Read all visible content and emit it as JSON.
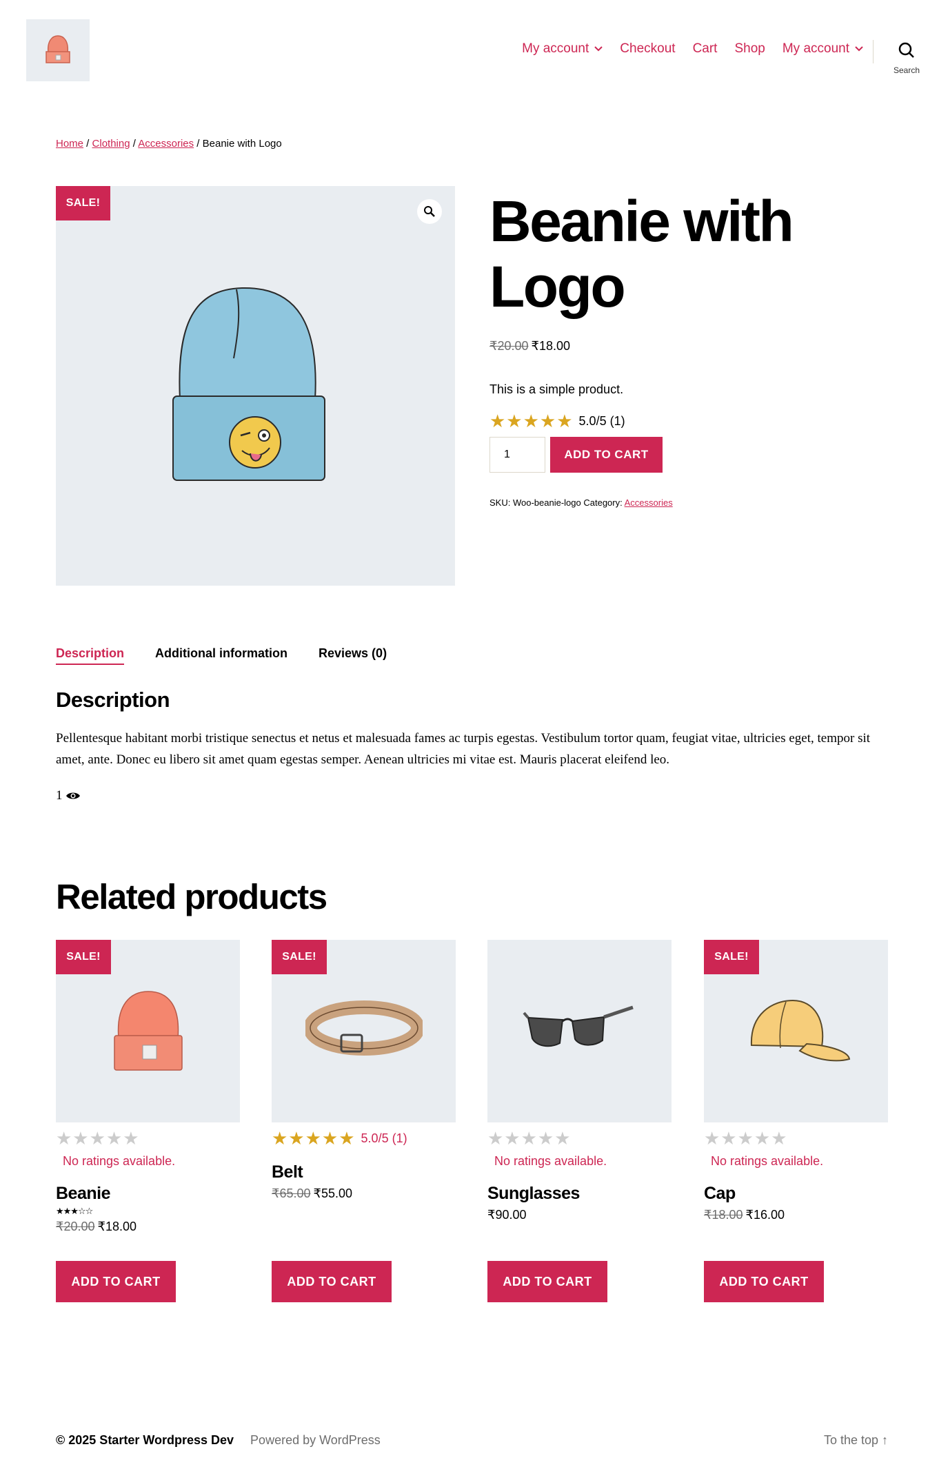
{
  "header": {
    "nav": [
      {
        "label": "My account",
        "has_dropdown": true
      },
      {
        "label": "Checkout",
        "has_dropdown": false
      },
      {
        "label": "Cart",
        "has_dropdown": false
      },
      {
        "label": "Shop",
        "has_dropdown": false
      },
      {
        "label": "My account",
        "has_dropdown": true
      }
    ],
    "search_label": "Search"
  },
  "breadcrumb": {
    "home": "Home",
    "sep": " / ",
    "clothing": "Clothing",
    "accessories": "Accessories",
    "current": "Beanie with Logo"
  },
  "product": {
    "sale_badge": "SALE!",
    "title_line1": "Beanie with",
    "title_line2": "Logo",
    "price_old": "₹20.00",
    "price_new": "₹18.00",
    "short_description": "This is a simple product.",
    "stars": "★★★★★",
    "rating_text": "5.0/5 (1)",
    "quantity": "1",
    "add_to_cart": "ADD TO CART",
    "sku_label": "SKU: Woo-beanie-logo",
    "category_label": "Category:",
    "category_link": "Accessories"
  },
  "tabs": [
    {
      "label": "Description",
      "active": true
    },
    {
      "label": "Additional information",
      "active": false
    },
    {
      "label": "Reviews (0)",
      "active": false
    }
  ],
  "description": {
    "heading": "Description",
    "text": "Pellentesque habitant morbi tristique senectus et netus et malesuada fames ac turpis egestas. Vestibulum tortor quam, feugiat vitae, ultricies eget, tempor sit amet, ante. Donec eu libero sit amet quam egestas semper. Aenean ultricies mi vitae est. Mauris placerat eleifend leo.",
    "view_count": "1"
  },
  "related": {
    "heading": "Related products",
    "products": [
      {
        "name": "Beanie",
        "sale": "SALE!",
        "stars": "★★★★★",
        "rating": "",
        "no_ratings": "No ratings available.",
        "mini_stars": "★★★☆☆",
        "price_old": "₹20.00",
        "price_new": "₹18.00",
        "button": "ADD TO CART"
      },
      {
        "name": "Belt",
        "sale": "SALE!",
        "stars": "★★★★★",
        "rating": "5.0/5 (1)",
        "no_ratings": "",
        "mini_stars": "",
        "price_old": "₹65.00",
        "price_new": "₹55.00",
        "button": "ADD TO CART"
      },
      {
        "name": "Sunglasses",
        "sale": "",
        "stars": "★★★★★",
        "rating": "",
        "no_ratings": "No ratings available.",
        "mini_stars": "",
        "price_old": "",
        "price_new": "₹90.00",
        "button": "ADD TO CART"
      },
      {
        "name": "Cap",
        "sale": "SALE!",
        "stars": "★★★★★",
        "rating": "",
        "no_ratings": "No ratings available.",
        "mini_stars": "",
        "price_old": "₹18.00",
        "price_new": "₹16.00",
        "button": "ADD TO CART"
      }
    ]
  },
  "footer": {
    "copyright": "© 2025 Starter Wordpress Dev",
    "powered": "Powered by WordPress",
    "to_top": "To the top ↑"
  },
  "colors": {
    "accent": "#cd2653",
    "image_bg": "#e9edf1",
    "star_gold": "#daa520",
    "star_empty": "#cccccc"
  }
}
